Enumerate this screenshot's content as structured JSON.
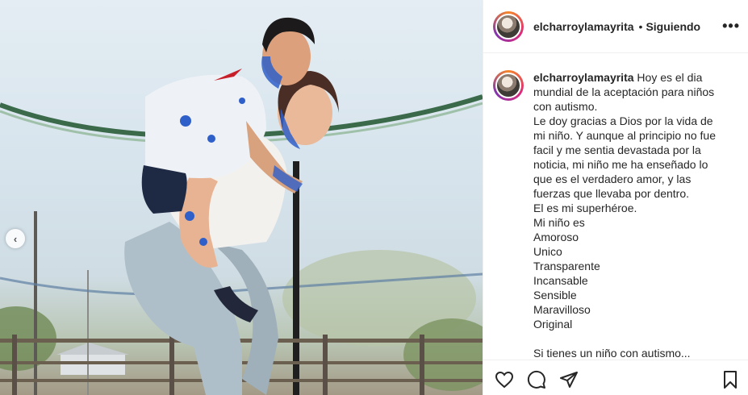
{
  "post": {
    "username": "elcharroylamayrita",
    "follow_separator": "•",
    "follow_status": "Siguiendo",
    "more_label": "•••"
  },
  "caption": {
    "username": "elcharroylamayrita",
    "first_line": "Hoy es el dia mundial de la aceptación para niños con autismo.",
    "lines": [
      "Le doy gracias a Dios por la vida de mi niño. Y aunque al principio no fue facil y me sentia devastada por la noticia, mi niño me ha enseñado lo que es el verdadero amor, y las fuerzas que llevaba por dentro.",
      "El es mi superhéroe.",
      "Mi niño es",
      "Amoroso",
      "Unico",
      "Transparente",
      "Incansable",
      "Sensible",
      "Maravilloso",
      "Original",
      " ",
      "Si tienes un niño con autismo..."
    ]
  },
  "icons": {
    "prev": "chevron-left-icon",
    "like": "heart-icon",
    "comment": "comment-icon",
    "share": "paper-plane-icon",
    "save": "bookmark-icon",
    "more": "more-options-icon"
  },
  "colors": {
    "text": "#262626",
    "border": "#efefef",
    "story_ring_start": "#f58529",
    "story_ring_mid": "#dd2a7b",
    "story_ring_end": "#8134af",
    "paint_blue": "#2f5fc9"
  }
}
